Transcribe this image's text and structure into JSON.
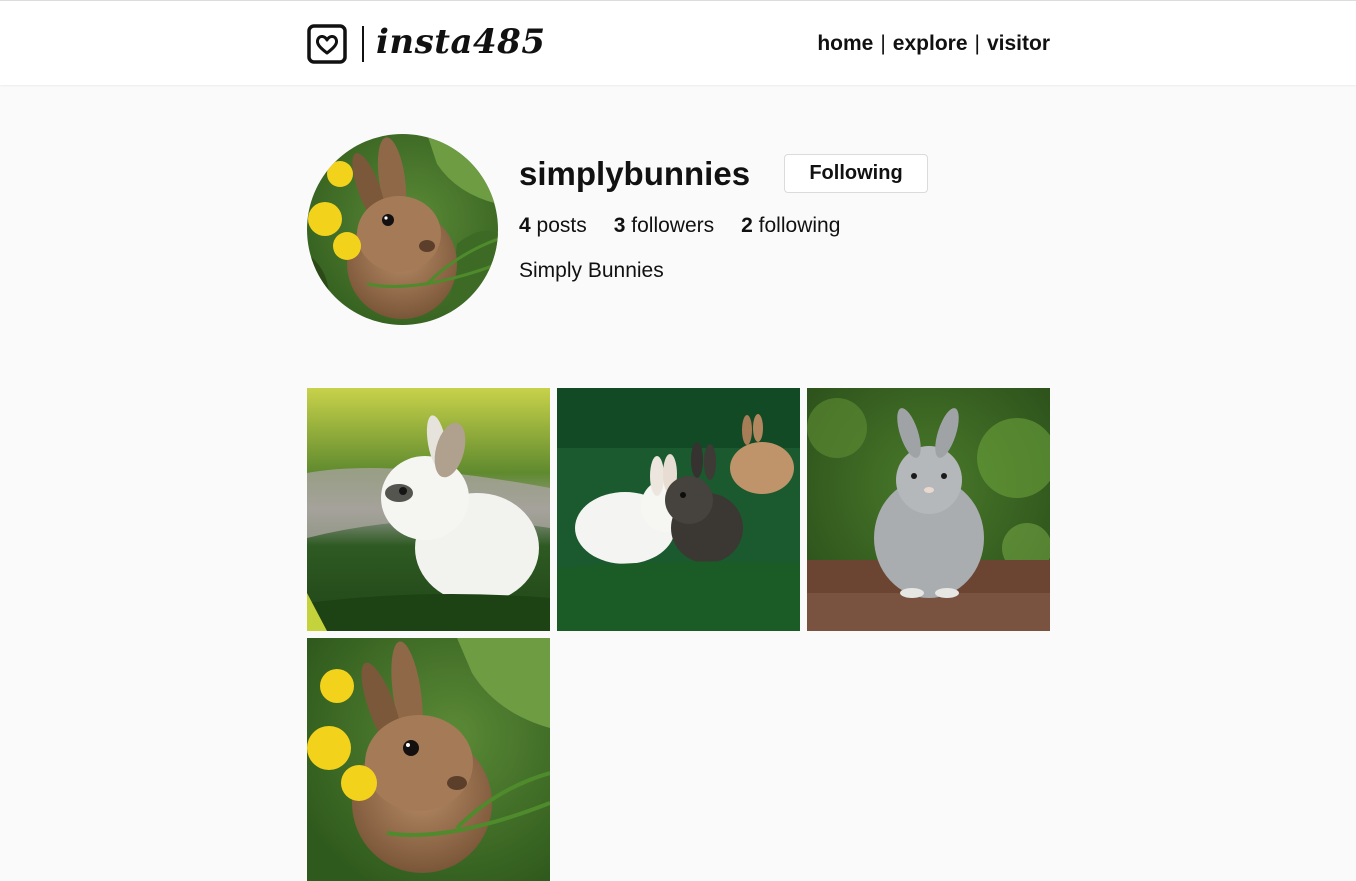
{
  "header": {
    "brand": "insta485",
    "logo_icon": "heart-square-icon",
    "nav": [
      {
        "label": "home"
      },
      {
        "label": "explore"
      },
      {
        "label": "visitor"
      }
    ],
    "nav_separator": "|"
  },
  "profile": {
    "username": "simplybunnies",
    "follow_button": "Following",
    "stats": {
      "posts_count": "4",
      "posts_label": "posts",
      "followers_count": "3",
      "followers_label": "followers",
      "following_count": "2",
      "following_label": "following"
    },
    "full_name": "Simply Bunnies"
  },
  "posts": [
    {
      "subject": "white-bunny-photo"
    },
    {
      "subject": "two-bunnies-on-grass-photo"
    },
    {
      "subject": "gray-bunny-photo"
    },
    {
      "subject": "brown-bunny-with-flowers-photo"
    }
  ],
  "colors": {
    "background": "#fafafa",
    "header_bg": "#ffffff",
    "text": "#111111"
  }
}
